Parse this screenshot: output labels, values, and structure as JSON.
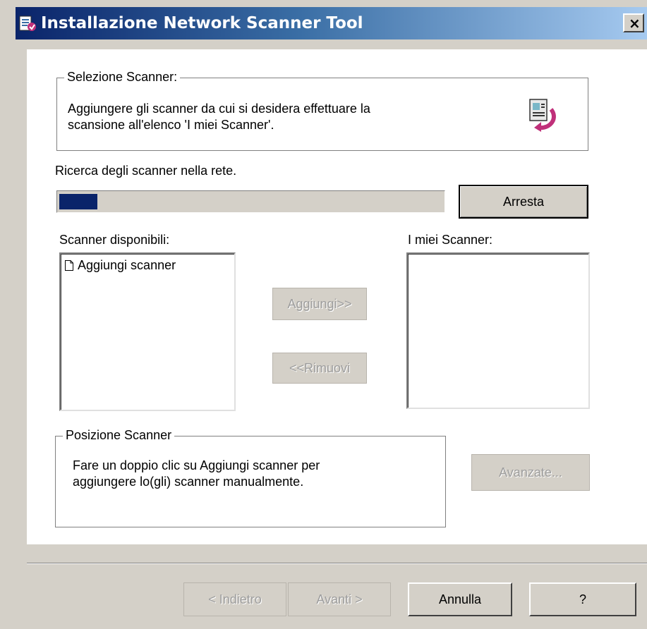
{
  "window": {
    "title": "Installazione Network Scanner Tool",
    "close_label": "×"
  },
  "selection_group": {
    "legend": "Selezione Scanner:",
    "line1": "Aggiungere gli scanner da cui si desidera effettuare la",
    "line2": "scansione all'elenco 'I miei Scanner'."
  },
  "search": {
    "status": "Ricerca degli scanner nella rete.",
    "progress_fraction": 0.1,
    "stop_label": "Arresta"
  },
  "available": {
    "label": "Scanner disponibili:",
    "items": [
      "Aggiungi scanner"
    ]
  },
  "mine": {
    "label": "I miei Scanner:",
    "items": []
  },
  "transfer": {
    "add_label": "Aggiungi>>",
    "remove_label": "<<Rimuovi"
  },
  "position_group": {
    "legend": "Posizione Scanner",
    "line1": "Fare un doppio clic su Aggiungi scanner per",
    "line2": "aggiungere lo(gli) scanner manualmente.",
    "advanced_label": "Avanzate..."
  },
  "footer": {
    "back_label": "< Indietro",
    "next_label": "Avanti >",
    "cancel_label": "Annulla",
    "help_label": "?"
  },
  "colors": {
    "accent": "#0a246a",
    "face": "#d4d0c8"
  }
}
